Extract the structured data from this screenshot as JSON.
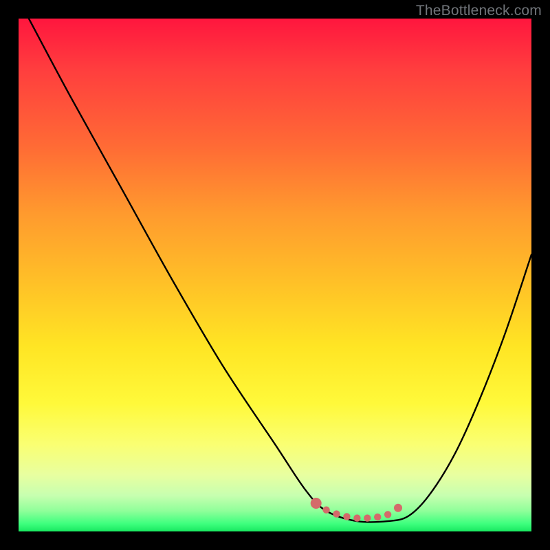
{
  "watermark": "TheBottleneck.com",
  "chart_data": {
    "type": "line",
    "title": "",
    "xlabel": "",
    "ylabel": "",
    "xlim": [
      0,
      100
    ],
    "ylim": [
      0,
      100
    ],
    "series": [
      {
        "name": "bottleneck-curve",
        "x": [
          2,
          10,
          20,
          30,
          40,
          50,
          56,
          60,
          66,
          72,
          76,
          80,
          85,
          90,
          95,
          100
        ],
        "values": [
          100,
          85,
          67,
          49,
          32,
          17,
          8,
          4,
          2,
          2,
          3,
          7,
          15,
          26,
          39,
          54
        ]
      }
    ],
    "markers": {
      "name": "optimal-range",
      "color": "#d46a6a",
      "points_x": [
        58,
        60,
        62,
        64,
        66,
        68,
        70,
        72,
        74
      ],
      "points_y": [
        5.5,
        4.2,
        3.4,
        2.9,
        2.6,
        2.6,
        2.8,
        3.3,
        4.6
      ]
    },
    "background": {
      "type": "vertical-gradient",
      "stops": [
        "#ff163e",
        "#ffe524",
        "#18e860"
      ]
    }
  }
}
